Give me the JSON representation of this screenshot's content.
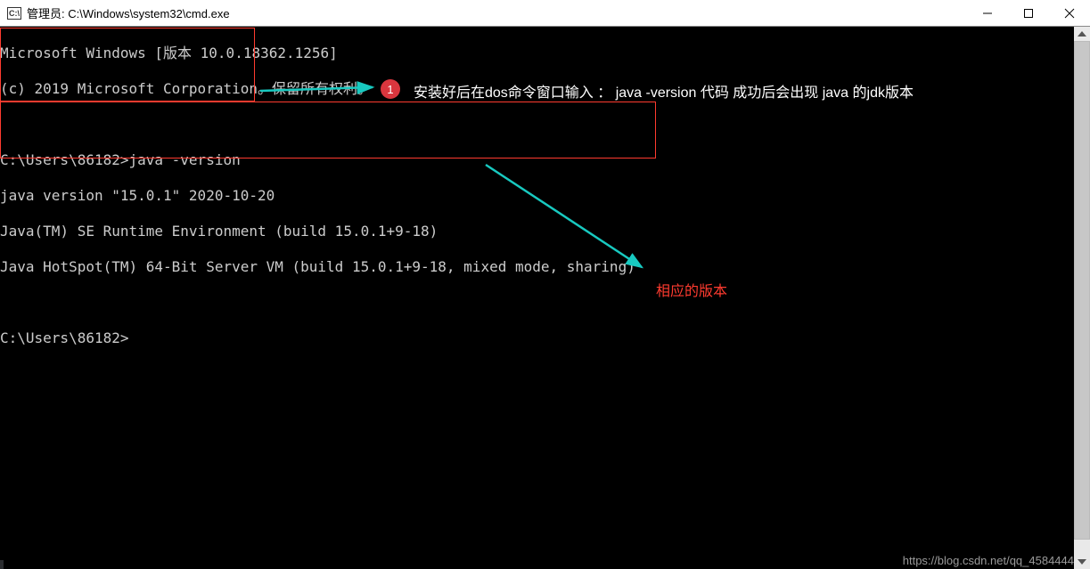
{
  "titlebar": {
    "icon_label": "C:\\",
    "title": "管理员: C:\\Windows\\system32\\cmd.exe"
  },
  "terminal": {
    "lines": [
      "Microsoft Windows [版本 10.0.18362.1256]",
      "(c) 2019 Microsoft Corporation。保留所有权利。",
      "",
      "C:\\Users\\86182>java -version",
      "java version \"15.0.1\" 2020-10-20",
      "Java(TM) SE Runtime Environment (build 15.0.1+9-18)",
      "Java HotSpot(TM) 64-Bit Server VM (build 15.0.1+9-18, mixed mode, sharing)",
      "",
      "C:\\Users\\86182>"
    ]
  },
  "annotations": {
    "badge_number": "1",
    "instruction": "安装好后在dos命令窗口输入 ： java -version 代码  成功后会出现 java 的jdk版本",
    "version_label": "相应的版本"
  },
  "watermark": "https://blog.csdn.net/qq_4584444"
}
